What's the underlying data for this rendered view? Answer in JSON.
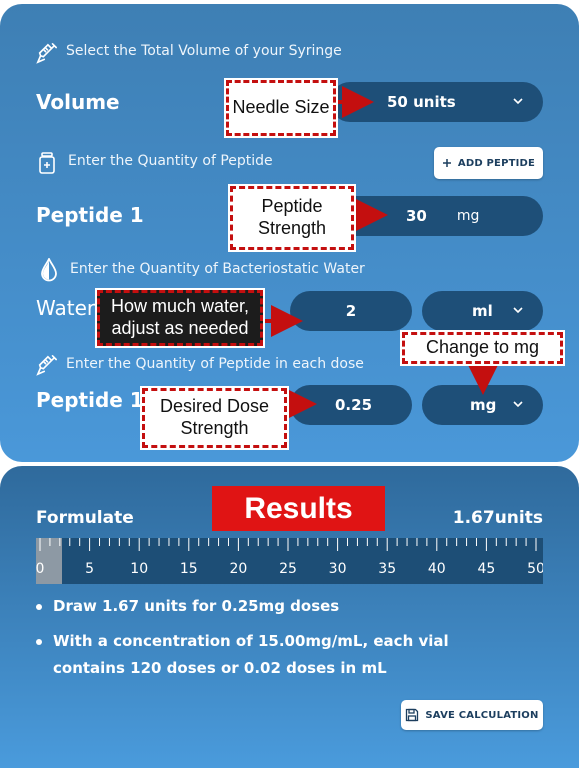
{
  "sections": {
    "syringe_label": "Select the Total Volume of your Syringe",
    "peptide_label": "Enter the Quantity of Peptide",
    "water_label": "Enter the Quantity of Bacteriostatic Water",
    "dose_label": "Enter the Quantity of Peptide in each dose"
  },
  "volume": {
    "label": "Volume",
    "selected": "50 units"
  },
  "peptide": {
    "label": "Peptide 1",
    "value": "30",
    "unit": "mg",
    "add_button": "ADD PEPTIDE"
  },
  "water": {
    "label": "Water",
    "value": "2",
    "unit_selected": "ml"
  },
  "dose": {
    "label": "Peptide 1",
    "value": "0.25",
    "unit_selected": "mg"
  },
  "callouts": {
    "needle": "Needle Size",
    "strength": "Peptide Strength",
    "water": "How much water, adjust as needed",
    "change": "Change to mg",
    "dose": "Desired Dose Strength"
  },
  "results": {
    "banner": "Results",
    "formulate_label": "Formulate",
    "units_value": "1.67units",
    "ruler_ticks": [
      "0",
      "5",
      "10",
      "15",
      "20",
      "25",
      "30",
      "35",
      "40",
      "45",
      "50"
    ],
    "ruler_fill_units": 1.67,
    "bullet1": "Draw 1.67 units for 0.25mg doses",
    "bullet2_line1": "With a concentration of 15.00mg/mL, each vial",
    "bullet2_line2": "contains 120 doses or 0.02 doses in mL",
    "save_button": "SAVE CALCULATION"
  },
  "icons": [
    "syringe-icon",
    "vial-icon",
    "water-drop-icon",
    "chevron-down-icon",
    "plus-icon",
    "save-icon"
  ],
  "colors": {
    "panel": "#4a98d9",
    "pill": "#1e4f78",
    "callout_border": "#c40f0f",
    "results_banner": "#e01414"
  }
}
